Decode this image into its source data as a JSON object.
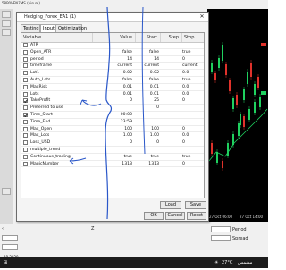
{
  "app": {
    "title": "58P0VEN7MS (visual)",
    "chart_time_labels": [
      "27 Oct 06:00",
      "27 Oct 14:00"
    ]
  },
  "dialog": {
    "title": "Hedging_Forex_EA1 (1)",
    "tabs": [
      {
        "label": "Testing"
      },
      {
        "label": "Inputs"
      },
      {
        "label": "Optimization"
      }
    ],
    "active_tab": "Inputs",
    "columns": {
      "variable": "Variable",
      "value": "Value",
      "start": "Start",
      "step": "Step",
      "stop": "Stop"
    },
    "rows": [
      {
        "name": "ATR",
        "value": "",
        "start": "",
        "stop": "",
        "checked": false
      },
      {
        "name": "Open_ATR",
        "value": "false",
        "start": "false",
        "stop": "true",
        "checked": false
      },
      {
        "name": "period",
        "value": "14",
        "start": "14",
        "stop": "0",
        "checked": false
      },
      {
        "name": "timeframe",
        "value": "current",
        "start": "current",
        "stop": "current",
        "checked": false
      },
      {
        "name": "Lot1",
        "value": "0.02",
        "start": "0.02",
        "stop": "0.0",
        "checked": false
      },
      {
        "name": "Auto_Lots",
        "value": "false",
        "start": "false",
        "stop": "true",
        "checked": false
      },
      {
        "name": "MaxRisk",
        "value": "0.01",
        "start": "0.01",
        "stop": "0.0",
        "checked": false
      },
      {
        "name": "Lots",
        "value": "0.01",
        "start": "0.01",
        "stop": "0.0",
        "checked": false
      },
      {
        "name": "TakeProfit",
        "value": "0",
        "start": "25",
        "stop": "0",
        "checked": true
      },
      {
        "name": "Preferred to use",
        "value": "",
        "start": "0",
        "stop": "",
        "checked": false
      },
      {
        "name": "Time_Start",
        "value": "00:00",
        "start": "",
        "stop": "",
        "checked": true
      },
      {
        "name": "Time_End",
        "value": "23:59",
        "start": "",
        "stop": "",
        "checked": false
      },
      {
        "name": "Max_Open",
        "value": "100",
        "start": "100",
        "stop": "0",
        "checked": false
      },
      {
        "name": "Max_Lots",
        "value": "1.00",
        "start": "1.00",
        "stop": "0.0",
        "checked": false
      },
      {
        "name": "Loss_USD",
        "value": "0",
        "start": "0",
        "stop": "0",
        "checked": false
      },
      {
        "name": "multiple_trend",
        "value": "",
        "start": "",
        "stop": "",
        "checked": false
      },
      {
        "name": "Continuous_trading",
        "value": "true",
        "start": "true",
        "stop": "true",
        "checked": false
      },
      {
        "name": "MagicNumber",
        "value": "1313",
        "start": "1313",
        "stop": "0",
        "checked": false
      }
    ],
    "buttons": {
      "load": "Load",
      "save": "Save",
      "ok": "OK",
      "cancel": "Cancel",
      "reset": "Reset"
    }
  },
  "bottom_panel": {
    "period_label": "Period",
    "spread_label": "Spread",
    "method_label": "ethod bas",
    "date_value": "18.2020",
    "zoom_label": "Z"
  },
  "taskbar": {
    "weather": "27°C",
    "weather_desc": "مشمس"
  },
  "colors": {
    "chart_bg": "#000000",
    "candle_green": "#1fd15f",
    "candle_red": "#e0322b",
    "annotation_blue": "#2a57c9",
    "dialog_bg": "#f4f4f4"
  }
}
